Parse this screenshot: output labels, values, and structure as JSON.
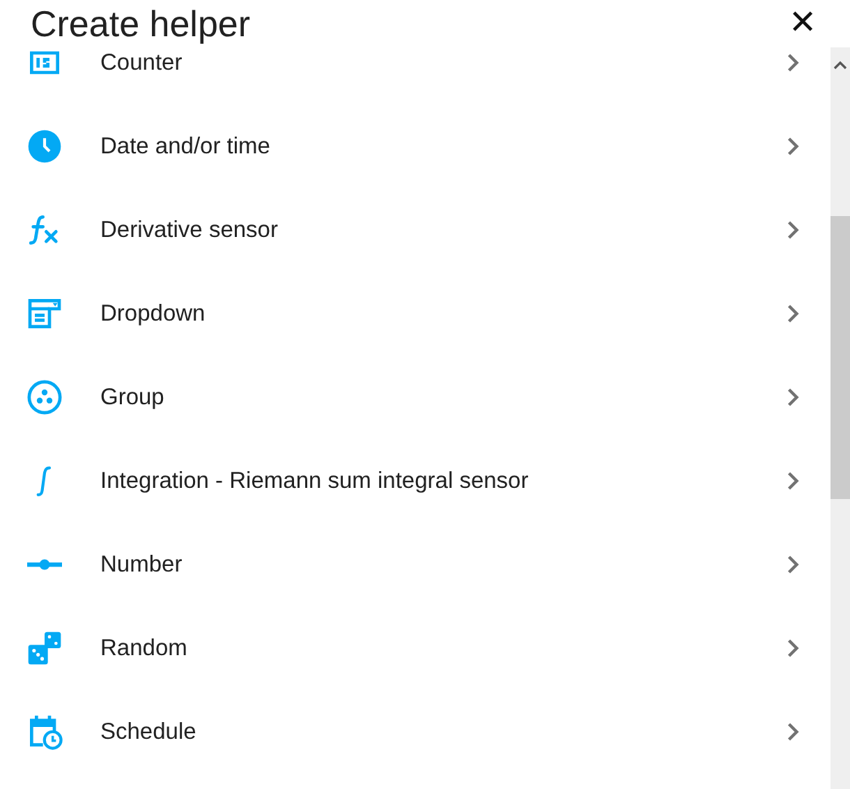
{
  "dialog": {
    "title": "Create helper",
    "close": "✕"
  },
  "items": [
    {
      "kind": "counter",
      "label": "Counter"
    },
    {
      "kind": "clock",
      "label": "Date and/or time"
    },
    {
      "kind": "function",
      "label": "Derivative sensor"
    },
    {
      "kind": "dropdown",
      "label": "Dropdown"
    },
    {
      "kind": "group",
      "label": "Group"
    },
    {
      "kind": "integral",
      "label": "Integration - Riemann sum integral sensor"
    },
    {
      "kind": "slider",
      "label": "Number"
    },
    {
      "kind": "dice",
      "label": "Random"
    },
    {
      "kind": "calendar",
      "label": "Schedule"
    }
  ]
}
